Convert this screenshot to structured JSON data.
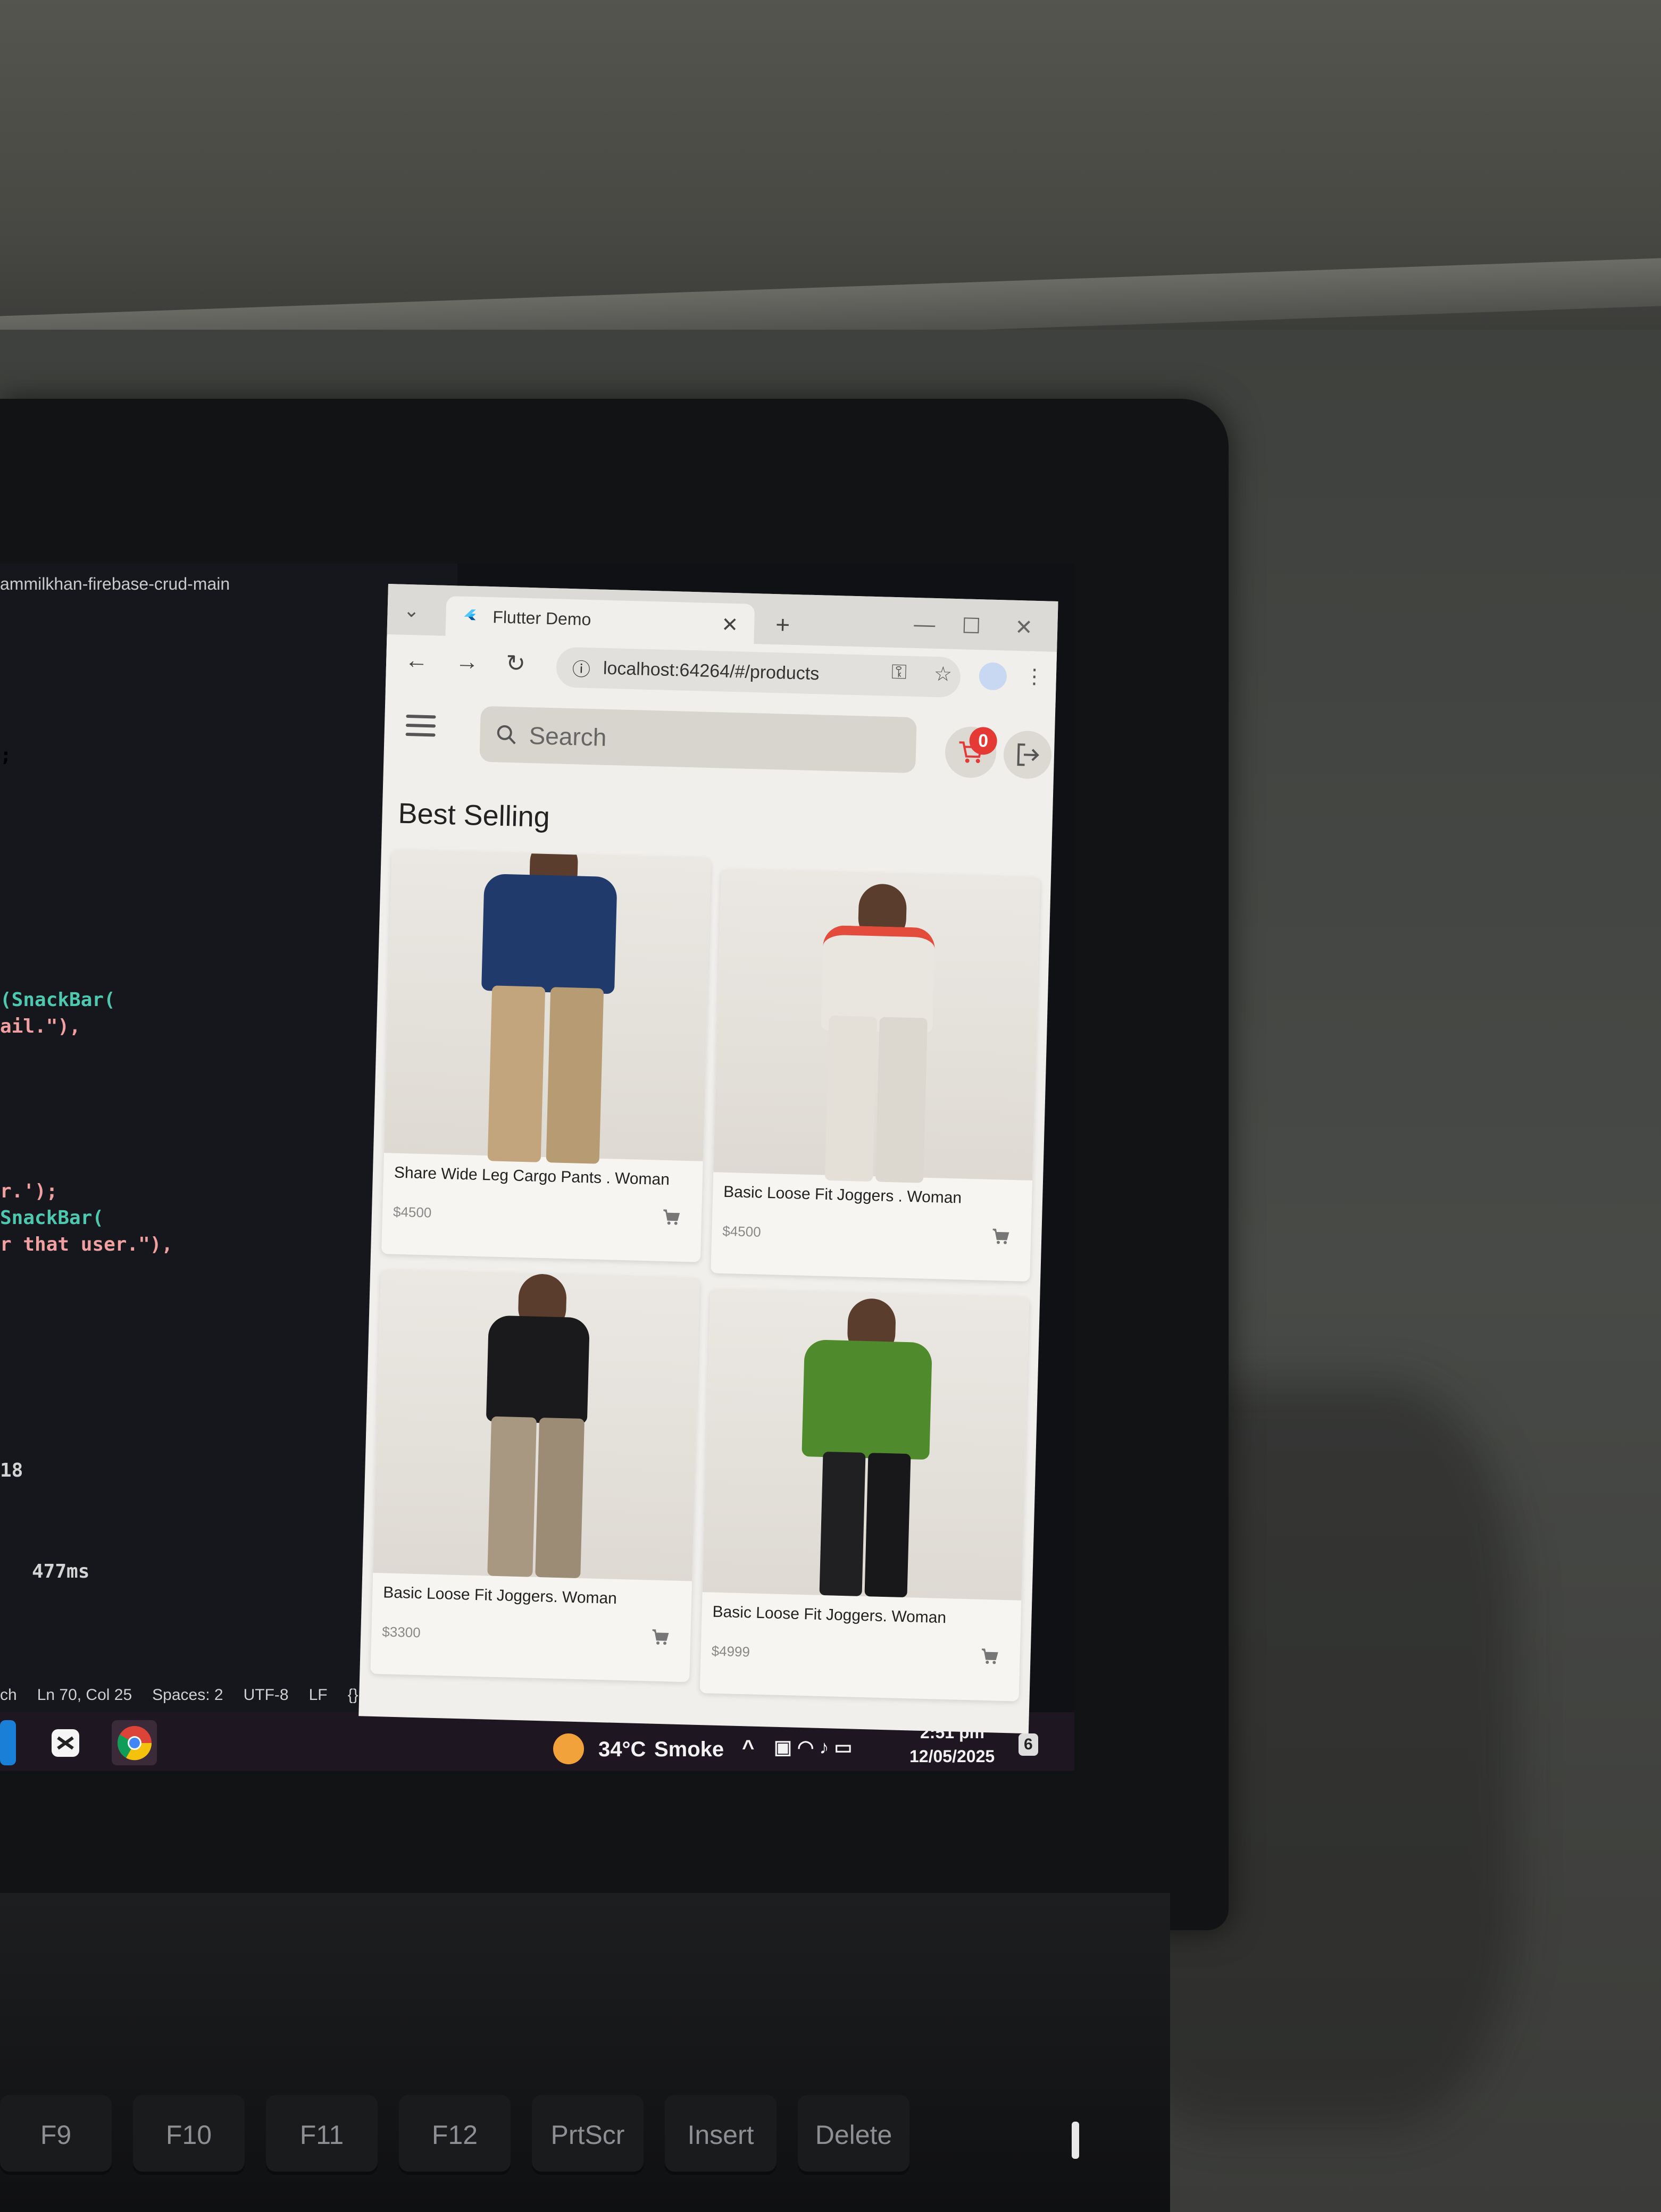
{
  "editor": {
    "title": "ammilkhan-firebase-crud-main",
    "code_lines": [
      {
        "text": ";",
        "color": "#d4d4d4"
      },
      {
        "text": "(SnackBar(",
        "color": "#4ec9b0"
      },
      {
        "text": "ail.\"),",
        "color": "#f0a0a0"
      },
      {
        "text": "r.');",
        "color": "#f0a0a0"
      },
      {
        "text": "SnackBar(",
        "color": "#4ec9b0"
      },
      {
        "text": "r that user.\"),",
        "color": "#f0a0a0"
      },
      {
        "text": "18",
        "color": "#d4d4d4"
      },
      {
        "text": "477ms",
        "color": "#d4d4d4"
      }
    ],
    "status": {
      "left": "ch",
      "position": "Ln 70, Col 25",
      "spaces": "Spaces: 2",
      "encoding": "UTF-8",
      "eol": "LF",
      "braces": "{}"
    }
  },
  "taskbar": {
    "weather_temp": "34°C",
    "weather_desc": "Smoke",
    "time": "2:51 pm",
    "date": "12/05/2025",
    "notification_count": "6"
  },
  "browser": {
    "tab_title": "Flutter Demo",
    "new_tab": "+",
    "url": "localhost:64264/#/products",
    "controls": {
      "minimize": "—",
      "maximize": "☐",
      "close": "✕"
    }
  },
  "app": {
    "search_placeholder": "Search",
    "cart_count": "0",
    "section_title": "Best Selling",
    "products": [
      {
        "name": "Share Wide Leg Cargo Pants . Woman",
        "price": "$4500",
        "top_color": "#1f3a6b",
        "bottom_color": "#c2a57c"
      },
      {
        "name": "Basic Loose Fit Joggers . Woman",
        "price": "$4500",
        "top_color": "#e9e5df",
        "bottom_color": "#e4e0d8"
      },
      {
        "name": "Basic Loose Fit Joggers. Woman",
        "price": "$3300",
        "top_color": "#1a1a1c",
        "bottom_color": "#a89882"
      },
      {
        "name": "Basic Loose Fit Joggers. Woman",
        "price": "$4999",
        "top_color": "#4f8a2c",
        "bottom_color": "#201f22"
      }
    ],
    "accent_color": "#e53935"
  },
  "keyboard": {
    "keys": [
      "F9",
      "F10",
      "F11",
      "F12",
      "PrtScr",
      "Insert",
      "Delete"
    ]
  }
}
